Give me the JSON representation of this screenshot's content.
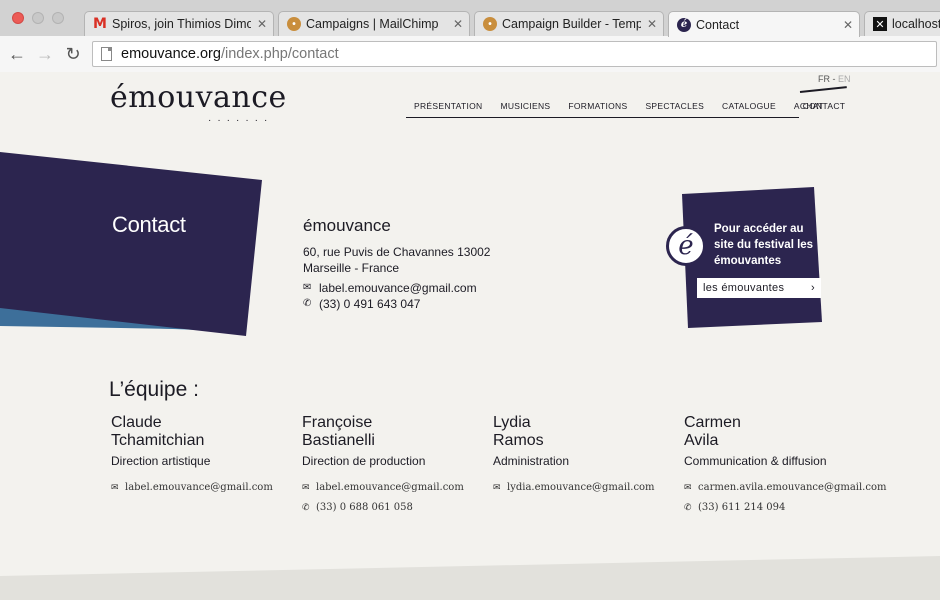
{
  "browser": {
    "tabs": [
      {
        "title": "Spiros, join Thimios Dimop",
        "favicon": "gmail-icon"
      },
      {
        "title": "Campaigns | MailChimp",
        "favicon": "mailchimp-icon"
      },
      {
        "title": "Campaign Builder - Templa",
        "favicon": "mailchimp-icon"
      },
      {
        "title": "Contact",
        "favicon": "emouvance-icon",
        "active": true
      },
      {
        "title": "localhost:",
        "favicon": "x-icon"
      }
    ],
    "url_host": "emouvance.org",
    "url_path": "/index.php/contact"
  },
  "site": {
    "logo": "émouvance",
    "logo_dots": "·······",
    "lang_fr": "FR",
    "lang_sep": " - ",
    "lang_en": "EN",
    "nav": [
      "PRÉSENTATION",
      "MUSICIENS",
      "FORMATIONS",
      "SPECTACLES",
      "CATALOGUE",
      "ACHAT"
    ],
    "nav_active": "CONTACT"
  },
  "hero": {
    "title": "Contact"
  },
  "org": {
    "name": "émouvance",
    "address1": "60, rue Puvis de Chavannes 13002",
    "address2": "Marseille - France",
    "email": "label.emouvance@gmail.com",
    "phone": "(33) 0 491 643 047"
  },
  "festival": {
    "text": "Pour accéder au site du festival les émouvantes",
    "button_label": "les émouvantes",
    "chevron": "›"
  },
  "team": {
    "title": "L’équipe :",
    "members": [
      {
        "first": "Claude",
        "last": "Tchamitchian",
        "role": "Direction artistique",
        "email": "label.emouvance@gmail.com",
        "phone": ""
      },
      {
        "first": "Françoise",
        "last": "Bastianelli",
        "role": "Direction de production",
        "email": "label.emouvance@gmail.com",
        "phone": "(33) 0 688 061 058"
      },
      {
        "first": "Lydia",
        "last": "Ramos",
        "role": "Administration",
        "email": "lydia.emouvance@gmail.com",
        "phone": ""
      },
      {
        "first": "Carmen",
        "last": "Avila",
        "role": "Communication & diffusion",
        "email": "carmen.avila.emouvance@gmail.com",
        "phone": "(33) 611 214 094"
      }
    ]
  },
  "icons": {
    "email": "✉",
    "phone": "✆"
  },
  "colors": {
    "navy": "#2c254f",
    "blue": "#5aa0c8",
    "bg": "#f3f2ee"
  }
}
